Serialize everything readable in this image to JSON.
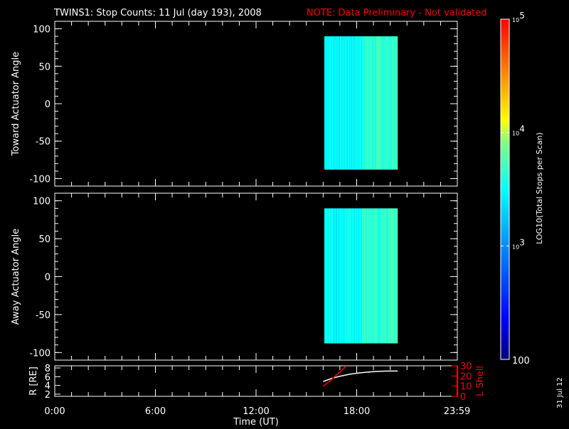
{
  "title": "TWINS1: Stop Counts: 11 Jul (day 193), 2008",
  "note": "NOTE: Data Preliminary - Not validated",
  "colors": {
    "note": "#ff0000",
    "lshell": "#ff0000",
    "axis": "#ffffff"
  },
  "footer_date": "31 Jul 12",
  "chart_data": [
    {
      "type": "heatmap",
      "ylabel": "Toward Actuator Angle",
      "ylim": [
        -110,
        110
      ],
      "yticks": [
        "100",
        "50",
        "0",
        "-50",
        "-100"
      ],
      "ytick_values": [
        100,
        50,
        0,
        -50,
        -100
      ],
      "data_time_range_hours": [
        16.05,
        20.45
      ],
      "data_angle_range": [
        -88,
        90
      ],
      "typical_log10_counts": 3.5
    },
    {
      "type": "heatmap",
      "ylabel": "Away Actuator Angle",
      "ylim": [
        -110,
        110
      ],
      "yticks": [
        "100",
        "50",
        "0",
        "-50",
        "-100"
      ],
      "ytick_values": [
        100,
        50,
        0,
        -50,
        -100
      ],
      "data_time_range_hours": [
        16.05,
        20.45
      ],
      "data_angle_range": [
        -88,
        90
      ],
      "typical_log10_counts": 3.5
    },
    {
      "type": "line",
      "ylabel": "R [RE]",
      "ylabel_right": "L Shell",
      "ylim": [
        1.5,
        8.5
      ],
      "ylim_right": [
        0,
        30
      ],
      "yticks": [
        "8",
        "6",
        "4",
        "2"
      ],
      "ytick_values": [
        8,
        6,
        4,
        2
      ],
      "yticks_right": [
        "30",
        "20",
        "10",
        "0"
      ],
      "ytick_values_right": [
        30,
        20,
        10,
        0
      ],
      "xlabel": "Time (UT)",
      "xticks": [
        "0:00",
        "6:00",
        "12:00",
        "18:00",
        "23:59"
      ],
      "xtick_values": [
        0,
        6,
        12,
        18,
        23.98
      ],
      "xlim": [
        0,
        24
      ],
      "series": [
        {
          "name": "R",
          "x": [
            16.0,
            16.5,
            17.0,
            17.5,
            18.0,
            18.5,
            19.0,
            19.5,
            20.0,
            20.45
          ],
          "y": [
            4.9,
            5.6,
            6.1,
            6.5,
            6.8,
            7.0,
            7.15,
            7.25,
            7.3,
            7.3
          ]
        },
        {
          "name": "L Shell",
          "x": [
            16.0,
            16.5,
            17.0,
            17.4
          ],
          "y": [
            10,
            16.5,
            24,
            30
          ]
        }
      ]
    }
  ],
  "colorbar": {
    "label": "LOG10(Total Stops per Scan)",
    "ticks": [
      {
        "base": "10",
        "exp": "5"
      },
      {
        "base": "10",
        "exp": "4"
      },
      {
        "base": "10",
        "exp": "3"
      },
      {
        "base": "100",
        "exp": ""
      }
    ],
    "range_log10": [
      2,
      5
    ]
  }
}
